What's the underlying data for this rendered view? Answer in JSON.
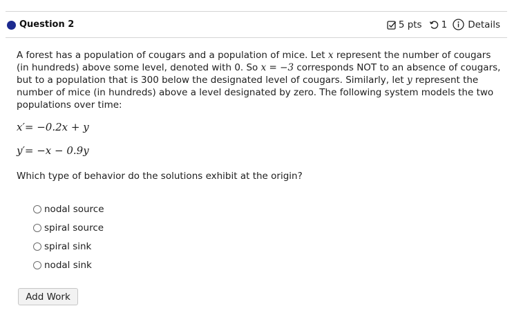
{
  "question": {
    "title": "Question 2",
    "points": "5 pts",
    "attempts": "1",
    "details_label": "Details"
  },
  "problem": {
    "p1": "A forest has a population of cougars and a population of mice. Let ",
    "var_x": "x",
    "p2": " represent the number of cougars (in hundreds) above some level, denoted with 0. So ",
    "eq_inline": "x = −3",
    "p3": " corresponds NOT to an absence of cougars, but to a population that is 300 below the designated level of cougars. Similarly, let ",
    "var_y": "y",
    "p4": " represent the number of mice (in hundreds) above a level designated by zero. The following system models the two populations over time:"
  },
  "equations": {
    "eq1": "x′= −0.2x + y",
    "eq2": "y′= −x − 0.9y"
  },
  "prompt": "Which type of behavior do the solutions exhibit at the origin?",
  "options": [
    {
      "label": "nodal source"
    },
    {
      "label": "spiral source"
    },
    {
      "label": "spiral sink"
    },
    {
      "label": "nodal sink"
    }
  ],
  "add_work_label": "Add Work"
}
